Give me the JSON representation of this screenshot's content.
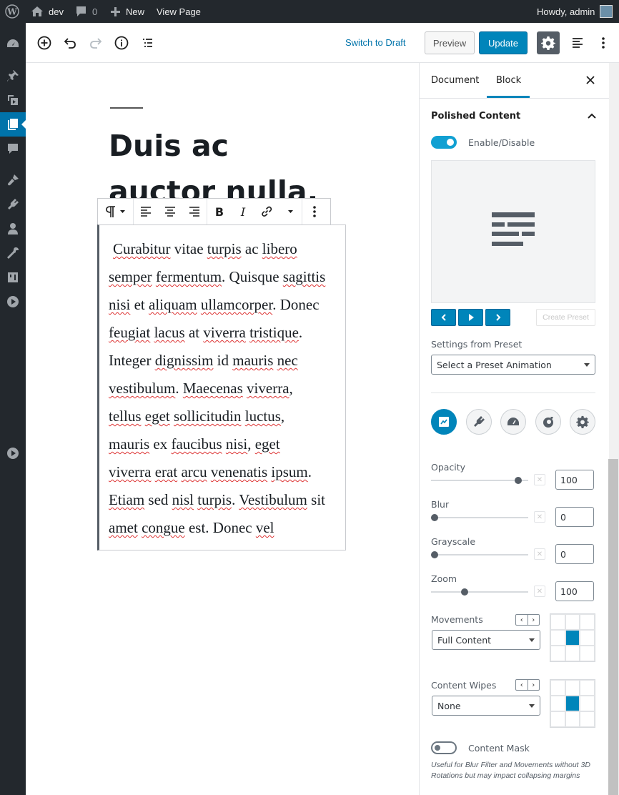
{
  "adminbar": {
    "site_name": "dev",
    "comments_count": "0",
    "new_label": "New",
    "view_page_label": "View Page",
    "howdy": "Howdy, admin"
  },
  "leftmenu": {
    "items": [
      "dashboard-icon",
      "pin-icon",
      "media-icon",
      "pages-icon",
      "comments-icon",
      "appearance-icon",
      "plugins-icon",
      "users-icon",
      "tools-icon",
      "settings-icon",
      "play-icon",
      "play-icon"
    ]
  },
  "toolbar": {
    "switch_to_draft": "Switch to Draft",
    "preview": "Preview",
    "update": "Update"
  },
  "editor": {
    "title": "Duis ac auctor nulla.",
    "paragraph_lines": [
      [
        "",
        "Curabitur",
        " vitae ",
        "turpis",
        " ac ",
        "libero"
      ],
      [
        "",
        "semper",
        " ",
        "fermentum",
        ". Quisque ",
        "sagittis"
      ],
      [
        "",
        "nisi",
        " et ",
        "aliquam",
        " ",
        "ullamcorper",
        ". Donec"
      ],
      [
        "",
        "feugiat",
        " ",
        "lacus",
        " at ",
        "viverra",
        " ",
        "tristique",
        "."
      ],
      [
        "Integer ",
        "dignissim",
        " id ",
        "mauris",
        " ",
        "nec"
      ],
      [
        "",
        "vestibulum",
        ". ",
        "Maecenas",
        " ",
        "viverra",
        ","
      ],
      [
        "",
        "tellus",
        " ",
        "eget",
        " ",
        "sollicitudin",
        " ",
        "luctus",
        ","
      ],
      [
        "",
        "mauris",
        " ex ",
        "faucibus",
        " ",
        "nisi",
        ", ",
        "eget"
      ],
      [
        "",
        "viverra",
        " ",
        "erat",
        " ",
        "arcu",
        " ",
        "venenatis",
        " ",
        "ipsum",
        "."
      ],
      [
        "",
        "Etiam",
        " sed ",
        "nisl",
        " ",
        "turpis",
        ". ",
        "Vestibulum",
        " sit"
      ],
      [
        "",
        "amet",
        " ",
        "congue",
        " est. Donec ",
        "vel"
      ]
    ]
  },
  "sidebar": {
    "tabs": {
      "document": "Document",
      "block": "Block"
    },
    "panel_title": "Polished Content",
    "enable_label": "Enable/Disable",
    "create_preset": "Create Preset",
    "settings_from_preset": "Settings from Preset",
    "preset_select": "Select a Preset Animation",
    "opacity_label": "Opacity",
    "opacity_value": "100",
    "opacity_level": 0.93,
    "blur_label": "Blur",
    "blur_value": "0",
    "blur_level": 0,
    "grayscale_label": "Grayscale",
    "grayscale_value": "0",
    "grayscale_level": 0,
    "zoom_label": "Zoom",
    "zoom_value": "100",
    "zoom_level": 0.33,
    "movements_label": "Movements",
    "movements_select": "Full Content",
    "wipes_label": "Content Wipes",
    "wipes_select": "None",
    "mask_label": "Content Mask",
    "mask_note": "Useful for Blur Filter and Movements without 3D Rotations but may impact collapsing margins",
    "accent_color": "#0085ba"
  }
}
